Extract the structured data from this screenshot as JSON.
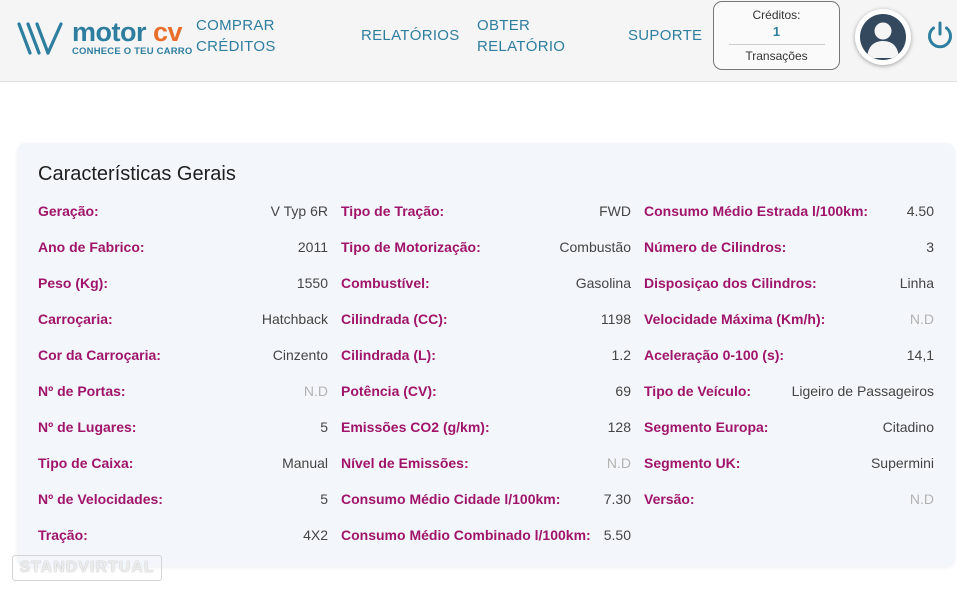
{
  "header": {
    "logo": {
      "brand_motor": "motor",
      "brand_cv": "cv",
      "tagline": "CONHECE O TEU CARRO"
    },
    "nav": [
      {
        "label": "COMPRAR CRÉDITOS"
      },
      {
        "label": "RELATÓRIOS"
      },
      {
        "label": "OBTER RELATÓRIO"
      },
      {
        "label": "SUPORTE"
      }
    ],
    "credits": {
      "label": "Créditos:",
      "count": "1",
      "transactions_label": "Transações"
    },
    "icons": {
      "avatar": "user-avatar-icon",
      "power": "power-icon"
    },
    "colors": {
      "primary": "#2e7ea0",
      "accent": "#e86e2c",
      "label": "#a0146a"
    }
  },
  "card": {
    "title": "Características Gerais",
    "columns": [
      [
        {
          "label": "Geração:",
          "value": "V Typ 6R"
        },
        {
          "label": "Ano de Fabrico:",
          "value": "2011"
        },
        {
          "label": "Peso (Kg):",
          "value": "1550"
        },
        {
          "label": "Carroçaria:",
          "value": "Hatchback"
        },
        {
          "label": "Cor da Carroçaria:",
          "value": "Cinzento"
        },
        {
          "label": "Nº de Portas:",
          "value": "N.D"
        },
        {
          "label": "Nº de Lugares:",
          "value": "5"
        },
        {
          "label": "Tipo de Caixa:",
          "value": "Manual"
        },
        {
          "label": "Nº de Velocidades:",
          "value": "5"
        },
        {
          "label": "Tração:",
          "value": "4X2"
        }
      ],
      [
        {
          "label": "Tipo de Tração:",
          "value": "FWD"
        },
        {
          "label": "Tipo de Motorização:",
          "value": "Combustão"
        },
        {
          "label": "Combustível:",
          "value": "Gasolina"
        },
        {
          "label": "Cilindrada (CC):",
          "value": "1198"
        },
        {
          "label": "Cilindrada (L):",
          "value": "1.2"
        },
        {
          "label": "Potência (CV):",
          "value": "69"
        },
        {
          "label": "Emissões CO2 (g/km):",
          "value": "128"
        },
        {
          "label": "Nível de Emissões:",
          "value": "N.D"
        },
        {
          "label": "Consumo Médio Cidade l/100km:",
          "value": "7.30"
        },
        {
          "label": "Consumo Médio Combinado l/100km:",
          "value": "5.50"
        }
      ],
      [
        {
          "label": "Consumo Médio Estrada l/100km:",
          "value": "4.50"
        },
        {
          "label": "Número de Cilindros:",
          "value": "3"
        },
        {
          "label": "Disposiçao dos Cilindros:",
          "value": "Linha"
        },
        {
          "label": "Velocidade Máxima (Km/h):",
          "value": "N.D"
        },
        {
          "label": "Aceleração 0-100 (s):",
          "value": "14,1"
        },
        {
          "label": "Tipo de Veículo:",
          "value": "Ligeiro de Passageiros"
        },
        {
          "label": "Segmento Europa:",
          "value": "Citadino"
        },
        {
          "label": "Segmento UK:",
          "value": "Supermini"
        },
        {
          "label": "Versão:",
          "value": "N.D"
        }
      ]
    ]
  },
  "watermark": "STANDVIRTUAL"
}
